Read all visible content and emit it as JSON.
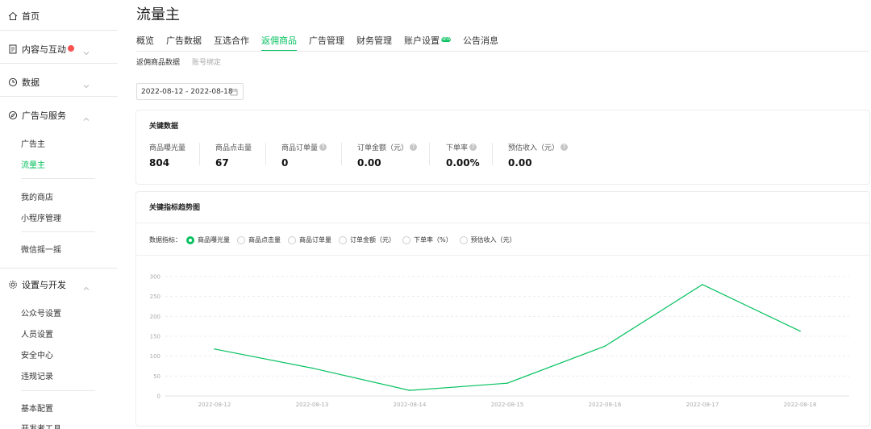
{
  "sidebar": {
    "home": "首页",
    "content": "内容与互动",
    "data": "数据",
    "ads": "广告与服务",
    "ads_items": [
      "广告主",
      "流量主"
    ],
    "shop_items": [
      "我的商店",
      "小程序管理"
    ],
    "shake": "微信摇一摇",
    "settings": "设置与开发",
    "settings_items": [
      "公众号设置",
      "人员设置",
      "安全中心",
      "违规记录"
    ],
    "extra_items": [
      "基本配置",
      "开发者工具"
    ]
  },
  "page": {
    "title": "流量主",
    "tabs": [
      "概览",
      "广告数据",
      "互选合作",
      "返佣商品",
      "广告管理",
      "财务管理",
      "账户设置",
      "公告消息"
    ],
    "new_badge": "NEW",
    "subtabs": [
      "返佣商品数据",
      "账号绑定"
    ],
    "date_range": "2022-08-12 - 2022-08-18"
  },
  "key_data": {
    "title": "关键数据",
    "metrics": [
      {
        "label": "商品曝光量",
        "value": "804"
      },
      {
        "label": "商品点击量",
        "value": "67"
      },
      {
        "label": "商品订单量",
        "value": "0"
      },
      {
        "label": "订单金额（元）",
        "value": "0.00"
      },
      {
        "label": "下单率",
        "value": "0.00%"
      },
      {
        "label": "预估收入（元）",
        "value": "0.00"
      }
    ]
  },
  "trend": {
    "title": "关键指标趋势图",
    "metric_label": "数据指标：",
    "options": [
      "商品曝光量",
      "商品点击量",
      "商品订单量",
      "订单金额（元）",
      "下单率（%）",
      "预估收入（元）"
    ]
  },
  "colors": {
    "accent": "#07c160",
    "badge_red": "#fa5151"
  },
  "chart_data": {
    "type": "line",
    "x": [
      "2022-08-12",
      "2022-08-13",
      "2022-08-14",
      "2022-08-15",
      "2022-08-16",
      "2022-08-17",
      "2022-08-18"
    ],
    "series": [
      {
        "values": [
          118,
          70,
          14,
          32,
          125,
          280,
          163
        ]
      }
    ],
    "ylim": [
      0,
      300
    ],
    "yticks": [
      0,
      50,
      100,
      150,
      200,
      250,
      300
    ],
    "grid": true,
    "color": "#07c160"
  }
}
